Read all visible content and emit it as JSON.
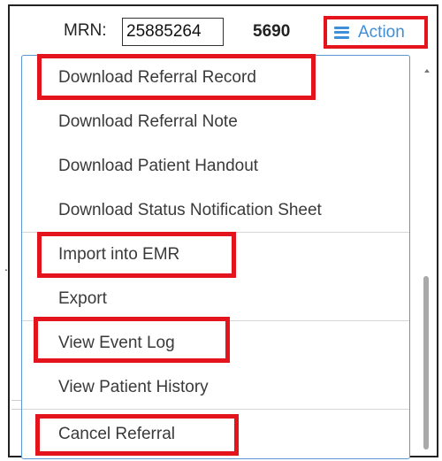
{
  "header": {
    "mrn_label": "MRN:",
    "mrn_value": "25885264",
    "ext_id": "5690",
    "action_label": "Action"
  },
  "menu": {
    "items": [
      {
        "label": "Download Referral Record"
      },
      {
        "label": "Download Referral Note"
      },
      {
        "label": "Download Patient Handout"
      },
      {
        "label": "Download Status Notification Sheet"
      },
      {
        "label": "Import into EMR"
      },
      {
        "label": "Export"
      },
      {
        "label": "View Event Log"
      },
      {
        "label": "View Patient History"
      },
      {
        "label": "Cancel Referral"
      }
    ]
  },
  "background": {
    "dot": "."
  },
  "colors": {
    "highlight": "#e3141b",
    "accent": "#3f8ed8",
    "menu_border": "#5a98d4"
  }
}
